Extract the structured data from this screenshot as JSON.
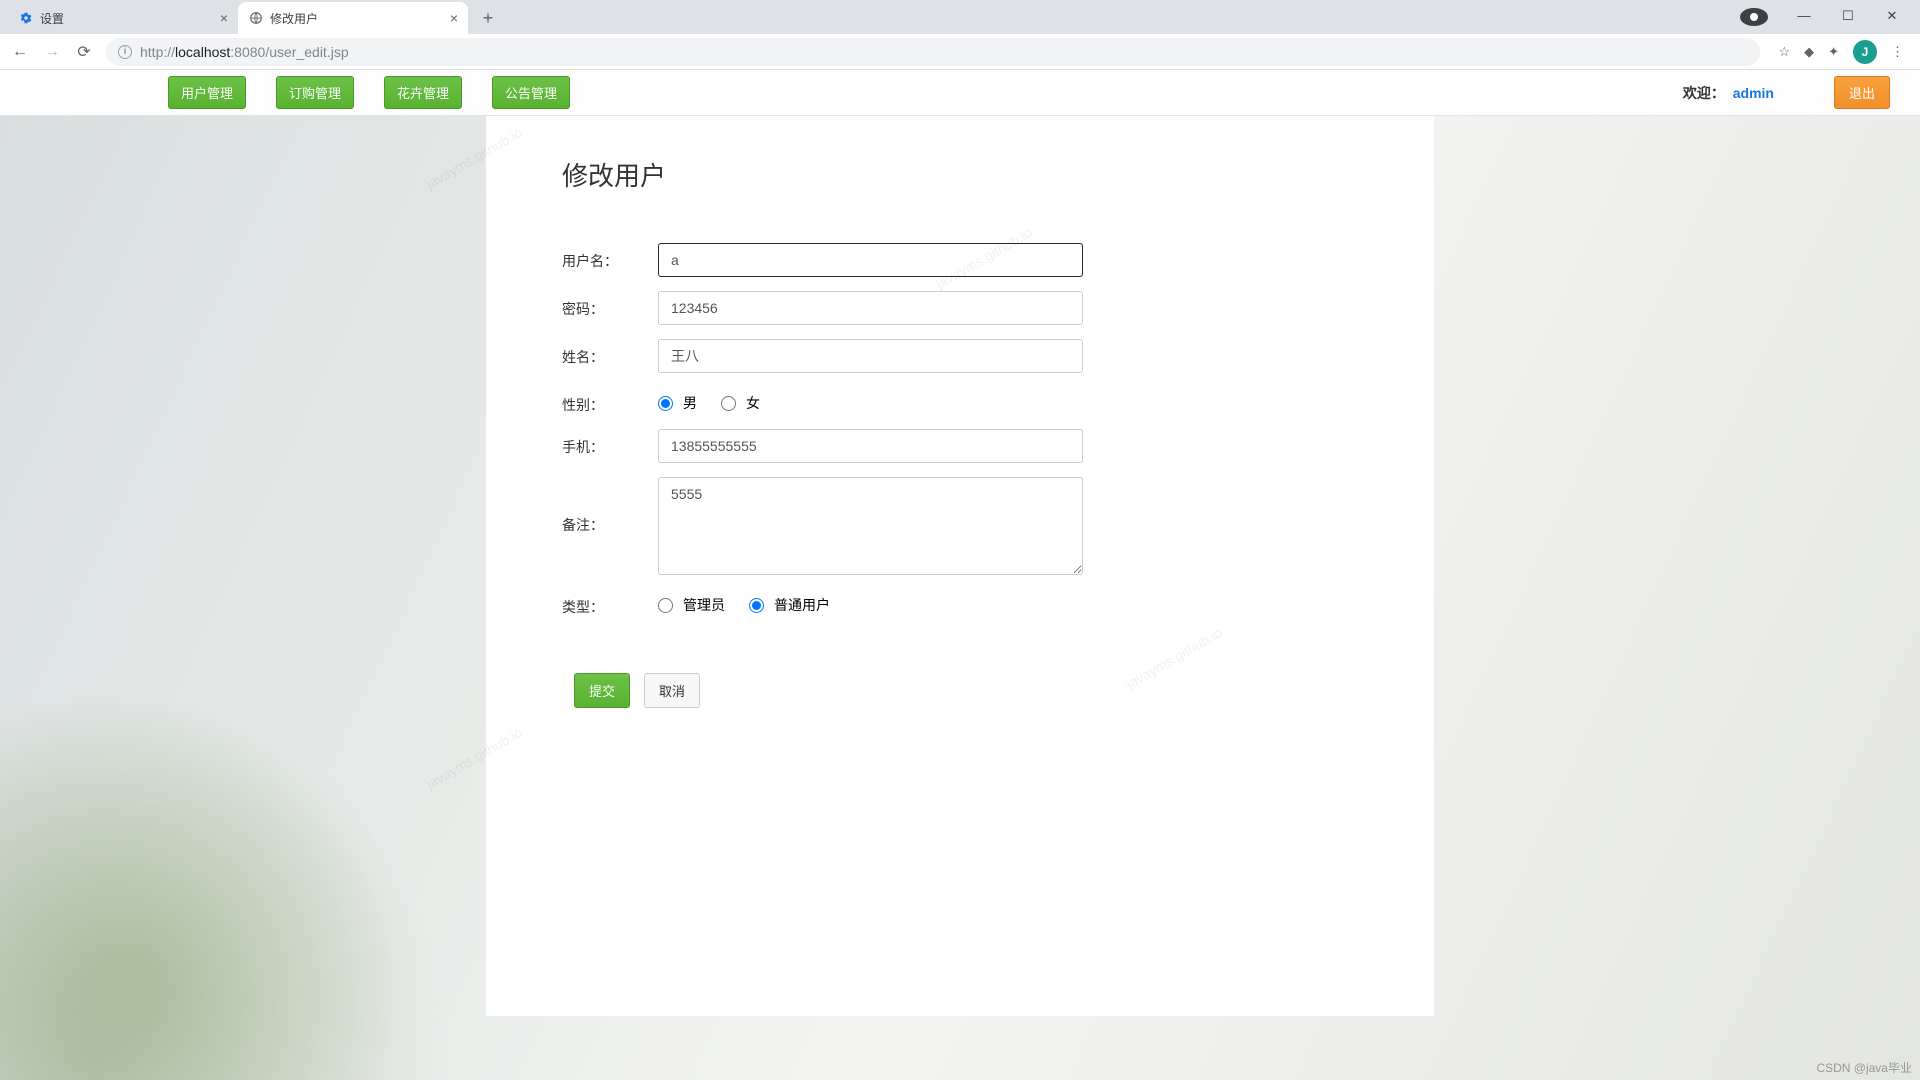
{
  "browser": {
    "tabs": [
      {
        "title": "设置"
      },
      {
        "title": "修改用户"
      }
    ],
    "url_prefix": "http://",
    "url_host": "localhost",
    "url_port": ":8080",
    "url_path": "/user_edit.jsp",
    "avatar_letter": "J"
  },
  "topbar": {
    "nav": [
      {
        "label": "用户管理"
      },
      {
        "label": "订购管理"
      },
      {
        "label": "花卉管理"
      },
      {
        "label": "公告管理"
      }
    ],
    "welcome_label": "欢迎：",
    "welcome_user": "admin",
    "logout_label": "退出"
  },
  "form": {
    "title": "修改用户",
    "username_label": "用户名：",
    "username_value": "a",
    "password_label": "密码：",
    "password_value": "123456",
    "realname_label": "姓名：",
    "realname_value": "王八",
    "gender_label": "性别：",
    "gender_male": "男",
    "gender_female": "女",
    "phone_label": "手机：",
    "phone_value": "13855555555",
    "remark_label": "备注：",
    "remark_value": "5555",
    "type_label": "类型：",
    "type_admin": "管理员",
    "type_user": "普通用户",
    "submit_label": "提交",
    "cancel_label": "取消"
  },
  "watermark": "javayms.github.io",
  "footer_wm": "CSDN @java毕业"
}
